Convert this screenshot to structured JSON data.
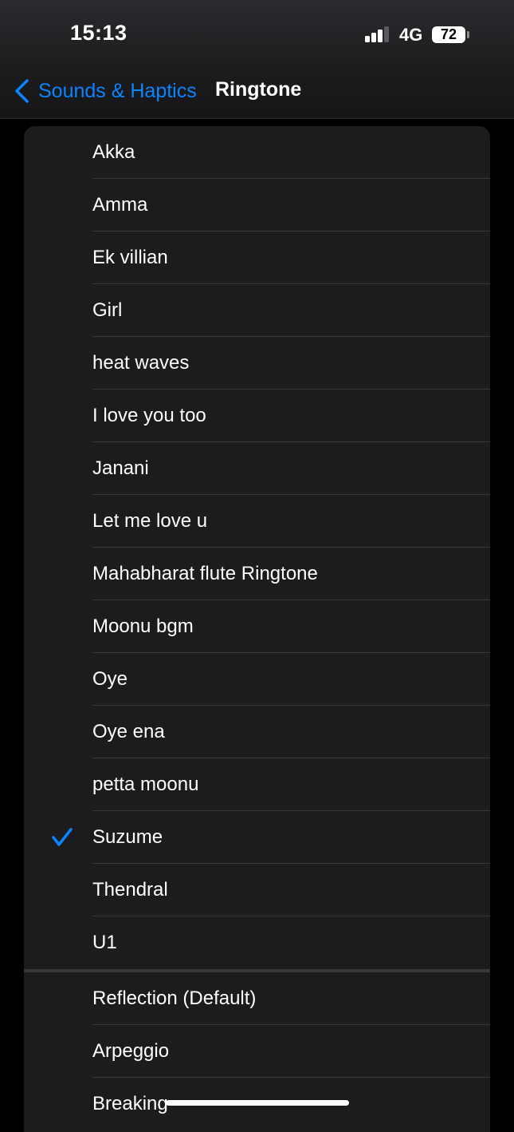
{
  "status_bar": {
    "time": "15:13",
    "network": "4G",
    "battery": "72"
  },
  "nav": {
    "back_label": "Sounds & Haptics",
    "title": "Ringtone"
  },
  "custom_tones": [
    {
      "label": "Akka",
      "selected": false
    },
    {
      "label": "Amma",
      "selected": false
    },
    {
      "label": "Ek villian",
      "selected": false
    },
    {
      "label": "Girl",
      "selected": false
    },
    {
      "label": "heat waves",
      "selected": false
    },
    {
      "label": "I love you too",
      "selected": false
    },
    {
      "label": "Janani",
      "selected": false
    },
    {
      "label": "Let me love u",
      "selected": false
    },
    {
      "label": "Mahabharat flute Ringtone",
      "selected": false
    },
    {
      "label": "Moonu bgm",
      "selected": false
    },
    {
      "label": "Oye",
      "selected": false
    },
    {
      "label": "Oye ena",
      "selected": false
    },
    {
      "label": "petta moonu",
      "selected": false
    },
    {
      "label": "Suzume",
      "selected": true
    },
    {
      "label": "Thendral",
      "selected": false
    },
    {
      "label": "U1",
      "selected": false
    }
  ],
  "system_tones": [
    {
      "label": "Reflection (Default)",
      "selected": false
    },
    {
      "label": "Arpeggio",
      "selected": false
    },
    {
      "label": "Breaking",
      "selected": false
    }
  ],
  "colors": {
    "accent": "#0a84ff",
    "background": "#000000",
    "cell": "#1c1c1e",
    "separator": "#38383a"
  },
  "icons": {
    "back": "chevron-left-icon",
    "check": "checkmark-icon",
    "signal": "cellular-signal-icon",
    "battery": "battery-icon"
  }
}
